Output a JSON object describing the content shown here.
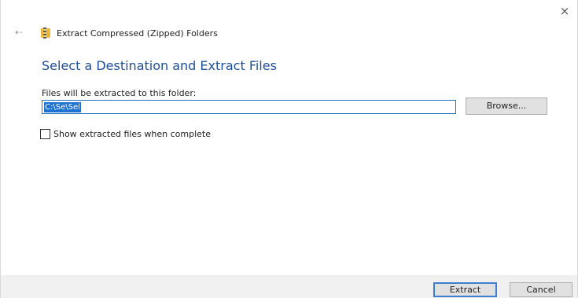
{
  "window": {
    "close_glyph": "×",
    "back_glyph": "⇠",
    "title": "Extract Compressed (Zipped) Folders",
    "icon": "zip-folder-icon"
  },
  "main": {
    "heading": "Select a Destination and Extract Files",
    "destination_label": "Files will be extracted to this folder:",
    "destination_value": "C:\\Se\\Sel",
    "browse_label": "Browse...",
    "show_files_label": "Show extracted files when complete",
    "show_files_checked": false
  },
  "footer": {
    "extract_label": "Extract",
    "cancel_label": "Cancel"
  },
  "colors": {
    "heading": "#1c4f9c",
    "accent": "#1e73d2",
    "footer_bg": "#f0f0f0"
  }
}
